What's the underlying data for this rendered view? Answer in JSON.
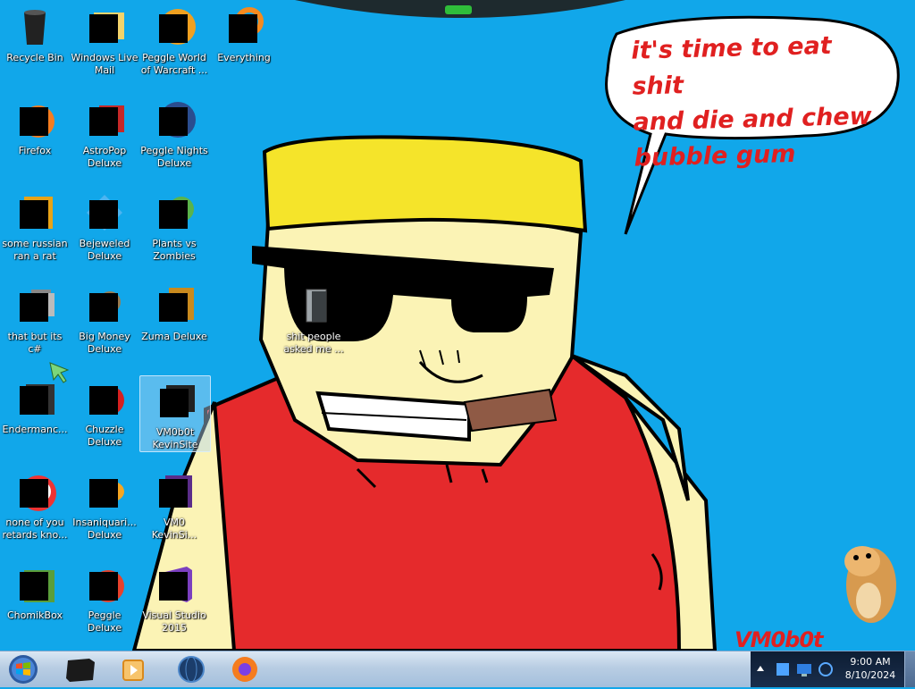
{
  "desktop": {
    "icons": [
      {
        "label": "Recycle Bin",
        "icon": "recycle-bin-icon"
      },
      {
        "label": "Windows Live Mail",
        "icon": "mail-icon"
      },
      {
        "label": "Peggle World of Warcraft ...",
        "icon": "peggle-icon"
      },
      {
        "label": "Everything",
        "icon": "search-icon"
      },
      {
        "label": "Firefox",
        "icon": "firefox-icon"
      },
      {
        "label": "AstroPop Deluxe",
        "icon": "astropop-icon"
      },
      {
        "label": "Peggle Nights Deluxe",
        "icon": "peggle-nights-icon"
      },
      {
        "label": "some russian ran a rat",
        "icon": "app-icon"
      },
      {
        "label": "Bejeweled Deluxe",
        "icon": "bejeweled-icon"
      },
      {
        "label": "Plants vs Zombies",
        "icon": "plants-vs-zombies-icon"
      },
      {
        "label": "that but its c#",
        "icon": "folder-stack-icon"
      },
      {
        "label": "Big Money Deluxe",
        "icon": "big-money-icon"
      },
      {
        "label": "Zuma Deluxe",
        "icon": "zuma-icon"
      },
      {
        "label": "Endermanc...",
        "icon": "terminal-icon"
      },
      {
        "label": "Chuzzle Deluxe",
        "icon": "chuzzle-icon"
      },
      {
        "label": "VM0b0t KevinSite",
        "icon": "vm-icon"
      },
      {
        "label": "none of you retards kno...",
        "icon": "app-icon"
      },
      {
        "label": "Insaniquari... Deluxe",
        "icon": "insaniquarium-icon"
      },
      {
        "label": "VM0 KevinSi...",
        "icon": "file-icon"
      },
      {
        "label": "ChomikBox",
        "icon": "chomikbox-icon"
      },
      {
        "label": "Peggle Deluxe",
        "icon": "peggle-icon"
      },
      {
        "label": "Visual Studio 2015",
        "icon": "visual-studio-icon"
      },
      {
        "label": "shit people asked me ...",
        "icon": "folder-icon"
      }
    ]
  },
  "wallpaper": {
    "speech_lines": [
      "it's time to eat shit",
      "and die and chew",
      "bubble gum"
    ],
    "signature": "VM0b0t",
    "colors": {
      "sky": "#11a7ea",
      "skin": "#fbf3b5",
      "hair": "#f5e42a",
      "shirt": "#e52a2c",
      "text": "#e02020"
    }
  },
  "taskbar": {
    "start": "windows-start-icon",
    "pinned": [
      {
        "name": "taskbar-terminal-button",
        "icon": "terminal-icon"
      },
      {
        "name": "taskbar-media-player-button",
        "icon": "media-player-icon"
      },
      {
        "name": "taskbar-globe-button",
        "icon": "globe-icon"
      },
      {
        "name": "taskbar-firefox-button",
        "icon": "firefox-icon"
      }
    ],
    "clock": {
      "time": "9:00 AM",
      "date": "8/10/2024"
    }
  }
}
